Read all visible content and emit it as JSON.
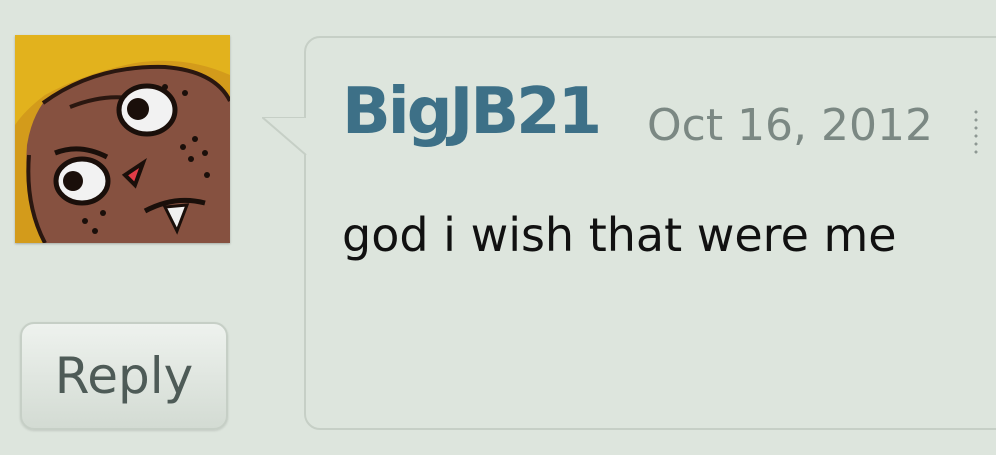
{
  "comment": {
    "username": "BigJB21",
    "date": "Oct 16, 2012",
    "text": "god i wish that were me",
    "reply_label": "Reply"
  },
  "avatar": {
    "icon": "cartoon-face-avatar"
  },
  "colors": {
    "background": "#dde5dd",
    "username": "#3d7087",
    "timestamp": "#7b8883",
    "border": "#c6cfc6",
    "text": "#111111"
  }
}
